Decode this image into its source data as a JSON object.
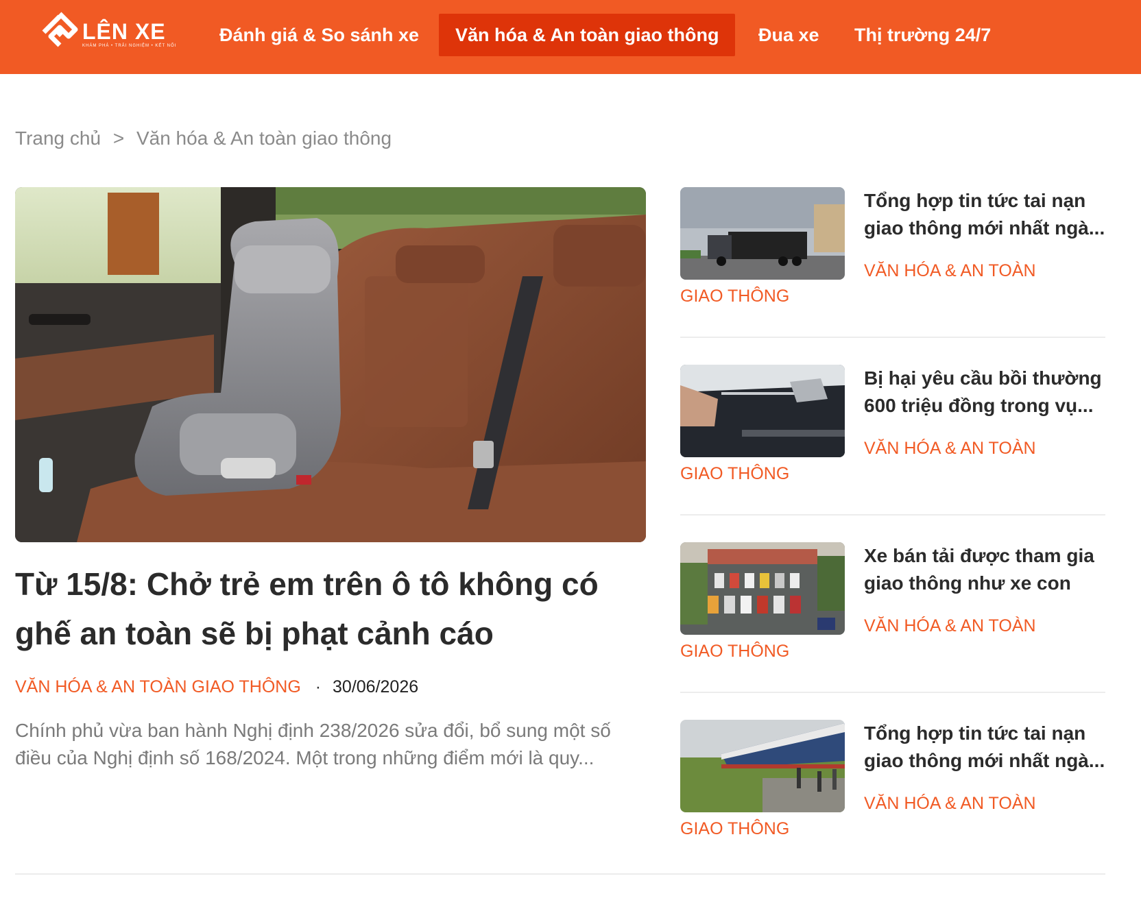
{
  "brand": {
    "name": "LÊN XE",
    "tagline": "KHÁM PHÁ • TRẢI NGHIỆM • KẾT NỐI"
  },
  "nav": {
    "items": [
      {
        "label": "Đánh giá & So sánh xe",
        "active": false
      },
      {
        "label": "Văn hóa & An toàn giao thông",
        "active": true
      },
      {
        "label": "Đua xe",
        "active": false
      },
      {
        "label": "Thị trường 24/7",
        "active": false
      }
    ]
  },
  "breadcrumb": {
    "home": "Trang chủ",
    "separator": ">",
    "current": "Văn hóa & An toàn giao thông"
  },
  "featured": {
    "image": "car-child-seat-photo",
    "title": "Từ 15/8: Chở trẻ em trên ô tô không có ghế an toàn sẽ bị phạt cảnh cáo",
    "category": "Văn hóa & An toàn giao thông",
    "dot": "·",
    "date": "30/06/2026",
    "excerpt": "Chính phủ vừa ban hành Nghị định 238/2026 sửa đổi, bổ sung một số điều của Nghị định số 168/2024. Một trong những điểm mới là quy..."
  },
  "side_articles": [
    {
      "title_line1": "Tổng hợp tin tức tai nạn",
      "title_line2": "giao thông mới nhất ngà...",
      "category": "Văn hóa & An toàn giao thông",
      "image": "truck-road-photo"
    },
    {
      "title_line1": "Bị hại yêu cầu bồi thường",
      "title_line2": "600 triệu đồng trong vụ...",
      "category": "Văn hóa & An toàn giao thông",
      "image": "car-door-photo"
    },
    {
      "title_line1": "Xe bán tải được tham gia",
      "title_line2": "giao thông như xe con",
      "category": "Văn hóa & An toàn giao thông",
      "image": "parking-lot-photo"
    },
    {
      "title_line1": "Tổng hợp tin tức tai nạn",
      "title_line2": "giao thông mới nhất ngà...",
      "category": "Văn hóa & An toàn giao thông",
      "image": "train-tracks-photo"
    }
  ],
  "colors": {
    "brand": "#f15a24",
    "nav_active": "#de3409",
    "title": "#2b2b2b",
    "muted": "#7a7a7a"
  }
}
